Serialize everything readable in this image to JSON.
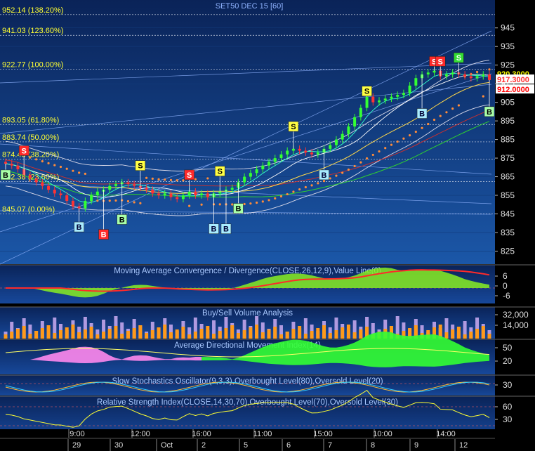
{
  "chart_data": {
    "type": "candlestick",
    "title": "SET50 DEC 15  [60]",
    "ylim": [
      818,
      960
    ],
    "y_ticks": [
      "945",
      "935",
      "925",
      "915",
      "905",
      "895",
      "885",
      "875",
      "865",
      "855",
      "845",
      "835",
      "825"
    ],
    "fib_levels": [
      {
        "label": "952.14 (138.20%)",
        "value": 952.14
      },
      {
        "label": "941.03 (123.60%)",
        "value": 941.03
      },
      {
        "label": "922.77 (100.00%)",
        "value": 922.77
      },
      {
        "label": "893.05 (61.80%)",
        "value": 893.05
      },
      {
        "label": "883.74 (50.00%)",
        "value": 883.74
      },
      {
        "label": "874.43 (38.20%)",
        "value": 874.43
      },
      {
        "label": "862.38 (23.60%)",
        "value": 862.38
      },
      {
        "label": "845.07 (0.00%)",
        "value": 845.07
      }
    ],
    "price_tags": [
      {
        "text": "920.3000",
        "value": 920.3,
        "color": "#ffff00",
        "bg": "#000000"
      },
      {
        "text": "917.3000",
        "value": 917.3,
        "color": "#ff3030",
        "bg": "#ffffff"
      },
      {
        "text": "912.0000",
        "value": 912.0,
        "color": "#ff0000",
        "bg": "#ffffff"
      }
    ],
    "signals": [
      {
        "text": "B",
        "bar": 0,
        "price": 866,
        "kind": "buy-green"
      },
      {
        "text": "S",
        "bar": 3,
        "price": 879,
        "kind": "sell-red"
      },
      {
        "text": "B",
        "bar": 12,
        "price": 838,
        "kind": "buy-cyan"
      },
      {
        "text": "B",
        "bar": 16,
        "price": 834,
        "kind": "buy-red"
      },
      {
        "text": "B",
        "bar": 19,
        "price": 842,
        "kind": "buy-green"
      },
      {
        "text": "S",
        "bar": 22,
        "price": 871,
        "kind": "sell-yellow"
      },
      {
        "text": "S",
        "bar": 30,
        "price": 866,
        "kind": "sell-red"
      },
      {
        "text": "B",
        "bar": 34,
        "price": 837,
        "kind": "buy-cyan"
      },
      {
        "text": "B",
        "bar": 36,
        "price": 837,
        "kind": "buy-cyan"
      },
      {
        "text": "S",
        "bar": 35,
        "price": 868,
        "kind": "sell-yellow"
      },
      {
        "text": "B",
        "bar": 38,
        "price": 848,
        "kind": "buy-green"
      },
      {
        "text": "S",
        "bar": 47,
        "price": 892,
        "kind": "sell-yellow"
      },
      {
        "text": "B",
        "bar": 52,
        "price": 866,
        "kind": "buy-cyan"
      },
      {
        "text": "S",
        "bar": 59,
        "price": 911,
        "kind": "sell-yellow"
      },
      {
        "text": "B",
        "bar": 68,
        "price": 899,
        "kind": "buy-cyan"
      },
      {
        "text": "S",
        "bar": 70,
        "price": 927,
        "kind": "sell-red"
      },
      {
        "text": "S",
        "bar": 71,
        "price": 927,
        "kind": "sell-red"
      },
      {
        "text": "S",
        "bar": 74,
        "price": 929,
        "kind": "sell-green"
      },
      {
        "text": "B",
        "bar": 79,
        "price": 900,
        "kind": "buy-green"
      }
    ],
    "closes": [
      872,
      871,
      869,
      866,
      864,
      862,
      860,
      858,
      856,
      855,
      852,
      849,
      848,
      852,
      855,
      857,
      858,
      860,
      861,
      862,
      861,
      860,
      859,
      858,
      856,
      855,
      856,
      854,
      853,
      855,
      857,
      855,
      856,
      854,
      856,
      857,
      858,
      859,
      862,
      865,
      867,
      869,
      871,
      873,
      875,
      877,
      879,
      880,
      879,
      878,
      877,
      878,
      880,
      882,
      885,
      888,
      892,
      897,
      902,
      908,
      905,
      906,
      907,
      908,
      909,
      910,
      914,
      918,
      920,
      921,
      922,
      919,
      920,
      921,
      920,
      919,
      918,
      919,
      920,
      917
    ],
    "panels": [
      {
        "key": "macd",
        "title": "Moving Average Convergence / Divergence(CLOSE,26,12,9),Value Line(0)",
        "ticks": [
          "6",
          "0",
          "-6"
        ]
      },
      {
        "key": "vol",
        "title": "Buy/Sell Volume Analysis",
        "ticks": [
          "32,000",
          "14,000"
        ]
      },
      {
        "key": "adx",
        "title": "Average Directional Movement Index(14)",
        "ticks": [
          "50",
          "20"
        ]
      },
      {
        "key": "stoch",
        "title": "Slow Stochastics Oscillator(9,3,3),Overbought Level(80),Oversold Level(20)",
        "ticks": [
          "30"
        ]
      },
      {
        "key": "rsi",
        "title": "Relative Strength Index(CLOSE,14,30,70),Overbought Level(70),Oversold Level(30)",
        "ticks": [
          "60",
          "30"
        ]
      }
    ],
    "x_time_labels": [
      "9:00",
      "12:00",
      "16:00",
      "11:00",
      "15:00",
      "10:00",
      "14:00"
    ],
    "x_date_labels": [
      "29",
      "30",
      "Oct",
      "2",
      "5",
      "6",
      "7",
      "8",
      "9",
      "12"
    ]
  }
}
